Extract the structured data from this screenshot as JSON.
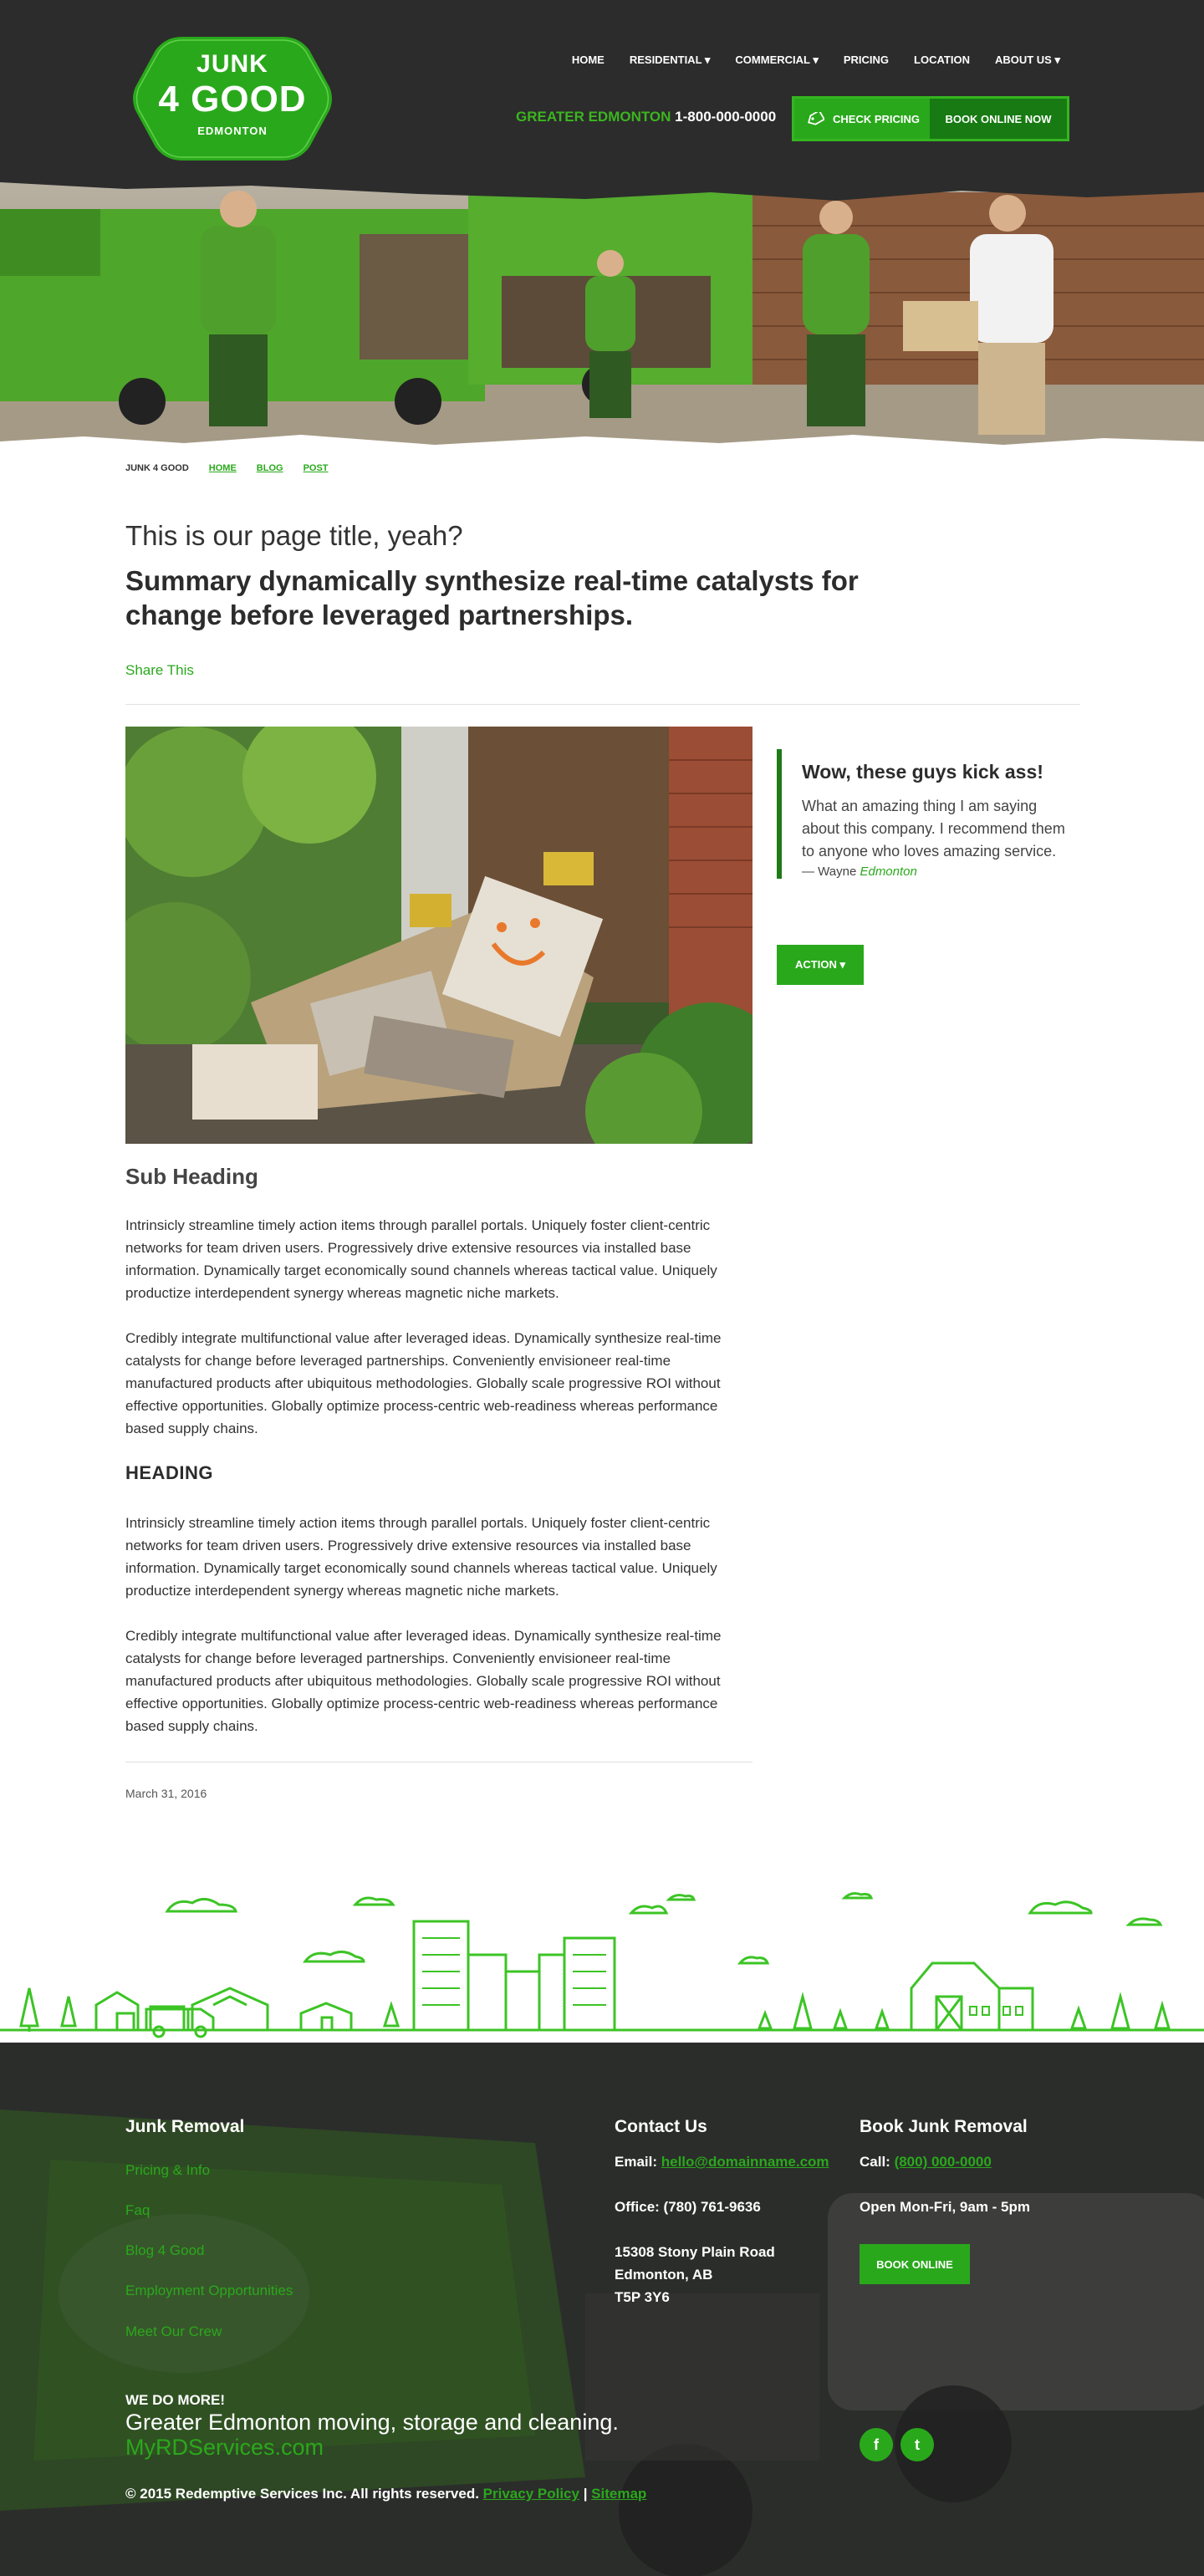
{
  "logo": {
    "line1": "JUNK",
    "line2": "4 GOOD",
    "line3": "EDMONTON"
  },
  "nav": {
    "items": [
      {
        "label": "HOME"
      },
      {
        "label": "RESIDENTIAL ▾"
      },
      {
        "label": "COMMERCIAL ▾"
      },
      {
        "label": "PRICING"
      },
      {
        "label": "LOCATION"
      },
      {
        "label": "ABOUT US ▾"
      }
    ]
  },
  "header": {
    "area_label": "GREATER EDMONTON",
    "phone": "1-800-000-0000",
    "check_pricing": "CHECK PRICING",
    "book_online": "BOOK ONLINE NOW"
  },
  "breadcrumb": {
    "brand": "JUNK 4 GOOD",
    "items": [
      "HOME",
      "BLOG",
      "POST"
    ]
  },
  "article": {
    "title": "This is our page title, yeah?",
    "summary": "Summary dynamically synthesize real-time catalysts for change before leveraged partnerships.",
    "share": "Share This",
    "subheading": "Sub Heading",
    "para1": "Intrinsicly streamline timely action items through parallel portals. Uniquely foster client-centric networks for team driven users. Progressively drive extensive resources via installed base information. Dynamically target economically sound channels whereas tactical value. Uniquely productize interdependent synergy whereas magnetic niche markets.",
    "para2": "Credibly integrate multifunctional value after leveraged ideas. Dynamically synthesize real-time catalysts for change before leveraged partnerships. Conveniently envisioneer real-time manufactured products after ubiquitous methodologies. Globally scale progressive ROI without effective opportunities. Globally optimize process-centric web-readiness whereas performance based supply chains.",
    "heading": "HEADING",
    "para3": "Intrinsicly streamline timely action items through parallel portals. Uniquely foster client-centric networks for team driven users. Progressively drive extensive resources via installed base information. Dynamically target economically sound channels whereas tactical value. Uniquely productize interdependent synergy whereas magnetic niche markets.",
    "para4": "Credibly integrate multifunctional value after leveraged ideas. Dynamically synthesize real-time catalysts for change before leveraged partnerships. Conveniently envisioneer real-time manufactured products after ubiquitous methodologies. Globally scale progressive ROI without effective opportunities. Globally optimize process-centric web-readiness whereas performance based supply chains.",
    "date": "March 31, 2016"
  },
  "testimonial": {
    "heading": "Wow, these guys kick ass!",
    "text": "What an amazing thing I am saying about this company. I recommend them to anyone who loves amazing service.",
    "author_prefix": "— Wayne ",
    "author_city": "Edmonton"
  },
  "action_button": "ACTION ▾",
  "footer": {
    "junk_heading": "Junk Removal",
    "links": [
      "Pricing & Info",
      "Faq",
      "Blog 4 Good",
      "Employment Opportunities",
      "Meet Our Crew"
    ],
    "contact_heading": "Contact Us",
    "email_label": "Email: ",
    "email": "hello@domainname.com",
    "office": "Office: (780) 761-9636",
    "address1": "15308 Stony Plain Road",
    "address2": "Edmonton, AB",
    "address3": "T5P 3Y6",
    "book_heading": "Book Junk Removal",
    "call_label": "Call: ",
    "call": "(800) 000-0000",
    "hours": "Open Mon-Fri, 9am - 5pm",
    "book_button": "BOOK ONLINE",
    "we_do": "WE DO MORE!",
    "tagline": "Greater Edmonton moving, storage and cleaning.",
    "site": "MyRDServices.com",
    "copyright": "© 2015 Redemptive Services Inc. All rights reserved. ",
    "privacy": "Privacy Policy",
    "separator": " | ",
    "sitemap": "Sitemap",
    "social": [
      {
        "icon": "facebook-icon",
        "glyph": "f"
      },
      {
        "icon": "twitter-icon",
        "glyph": "t"
      }
    ]
  },
  "colors": {
    "brand_green": "#2aa81c",
    "dark_green": "#177a12",
    "header_bg": "#2c2c2c",
    "footer_bg": "#2b2d2b"
  }
}
